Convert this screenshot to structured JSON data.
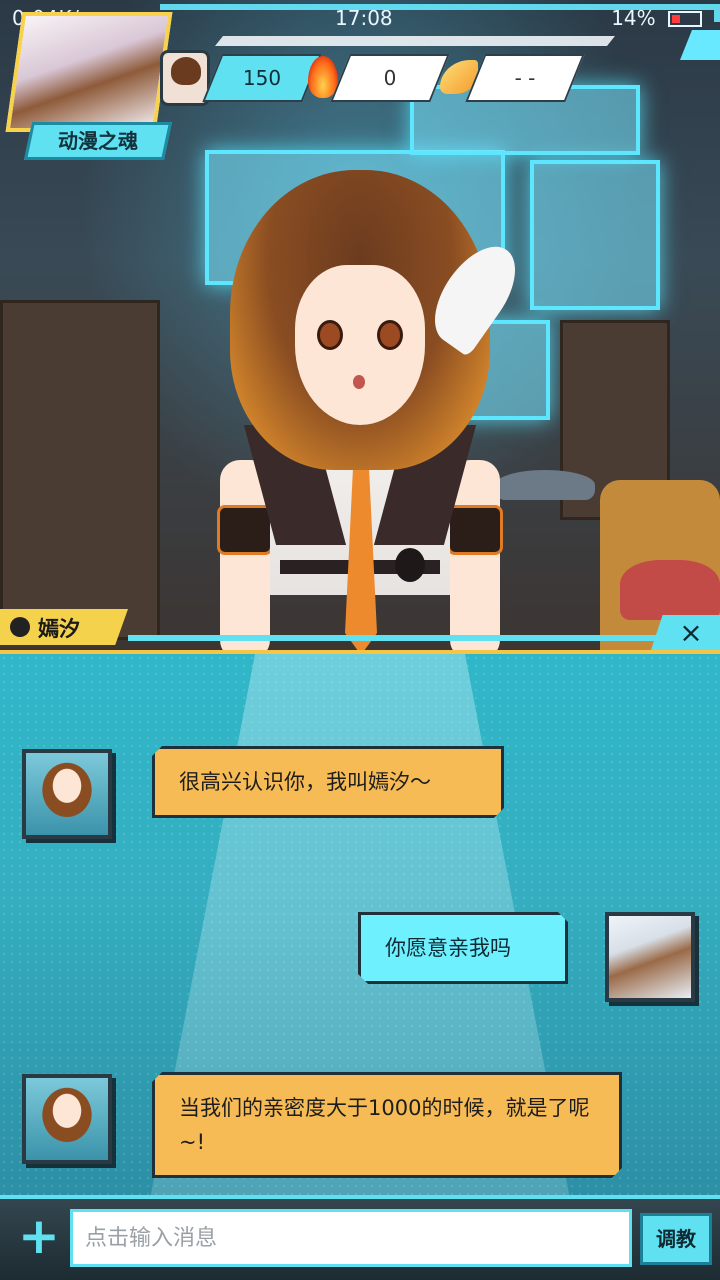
{
  "status_bar": {
    "speed": "0.04K/s",
    "time": "17:08",
    "battery": "14%"
  },
  "profile": {
    "title": "动漫之魂"
  },
  "stats": {
    "intimacy": "150",
    "fire": "0",
    "wing": "- -"
  },
  "character": {
    "name": "嫣汐"
  },
  "close_label": "×",
  "messages": [
    {
      "from": "character",
      "text": "很高兴认识你，我叫嫣汐～"
    },
    {
      "from": "user",
      "text": "你愿意亲我吗"
    },
    {
      "from": "character",
      "text": "当我们的亲密度大于1000的时候，就是了呢~!"
    }
  ],
  "input": {
    "placeholder": "点击输入消息",
    "plus_label": "+",
    "teach_label": "调教"
  }
}
